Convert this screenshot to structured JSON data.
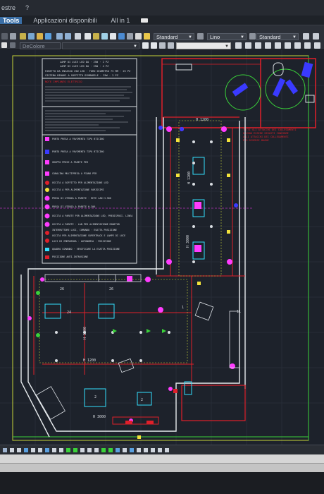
{
  "menu": {
    "items": [
      "estre",
      "?"
    ]
  },
  "tabs": [
    {
      "label": "Tools",
      "active": true
    },
    {
      "label": "Applicazioni disponibili",
      "active": false
    },
    {
      "label": "All in 1",
      "active": false
    }
  ],
  "ribbon": {
    "layer_color": "DeColore",
    "text_style": "Standard",
    "linetype": "Lino",
    "dim_style": "Standard"
  },
  "colors": {
    "canvas": "#1d222b",
    "wall": "#e8ecef",
    "red": "#e0202a",
    "magenta": "#ff3cff",
    "cyan": "#33e0ff",
    "green": "#3ad23a",
    "yellow": "#f3e33b",
    "blue": "#3a3aff"
  },
  "legend": {
    "header_lines": [
      "LAMP DI LUCE LED DA · 25W · 2 PZ",
      "LAMP DI LUCE LED DA · 25W · 4 PZ",
      "FARETTO DA INCASSO 25W LED · FORO DIAMETRO 75 MM · 25 PZ",
      "SISTEMA BINARI A SOFFITTO DIMMABILE · 25W · 2 PZ"
    ],
    "notes_title": "NOTE IMPIANTO ELETTRICO",
    "entries": [
      "PUNTO PRESA A PAVIMENTO TIPO BTICINO",
      "PUNTO PRESA A PAVIMENTO TIPO BTICINO",
      "GRUPPO PRESE A PARETE PER",
      "CANALINA MULTIPRESA A PIANO PER",
      "USCITA A SOFFITTO PER ALIMENTAZIONE LED",
      "USCITA A PER ALIMENTAZIONE VARISSIMI",
      "PRESA DI UTENZA A PARETE · RETE LAN H.300",
      "PRESA DI UTENZA A PARETE H.300",
      "USCITA A PARETE PER ALIMENTAZIONE LED, PREDISPOSI. LINEA",
      "USCITA A PARETE · LAN PER ALIMENTAZIONE MONITOR",
      "INTERRUTTORE LUCI, COMANDO · ESATTA POSIZIONE",
      "USCITA PER ALIMENTAZIONE SUPERTRACK E LAMPE DI LUCE",
      "LUCI DI EMERGENZA · AUTONOMIA · POSIZIONE",
      "QUADRO COMANDO · VERIFICARE LA ESATTA POSIZIONE",
      "POSIZIONE ANTI-INTRUSIONE"
    ]
  },
  "red_note": [
    "TUTTI GLI ATTACCHI DEI COLLEGAMENTI",
    "DEVONO ESSERE SEGUITI CONFORMI",
    "AGLI ATTACCHI DEI COLLEGAMENTI",
    "PER DIVERSI BAGNI"
  ],
  "dimensions": {
    "h1200_a": "H 1200",
    "h1200_b": "H 1200",
    "h1200_c": "H 1200",
    "h1200_d": "H 1200",
    "h3000": "H 3000",
    "h3000_b": "H 3000",
    "num_26a": "26",
    "num_26b": "26",
    "num_24": "24",
    "num_2a": "2",
    "num_2b": "2",
    "num_1": "1",
    "num_11": "11"
  }
}
